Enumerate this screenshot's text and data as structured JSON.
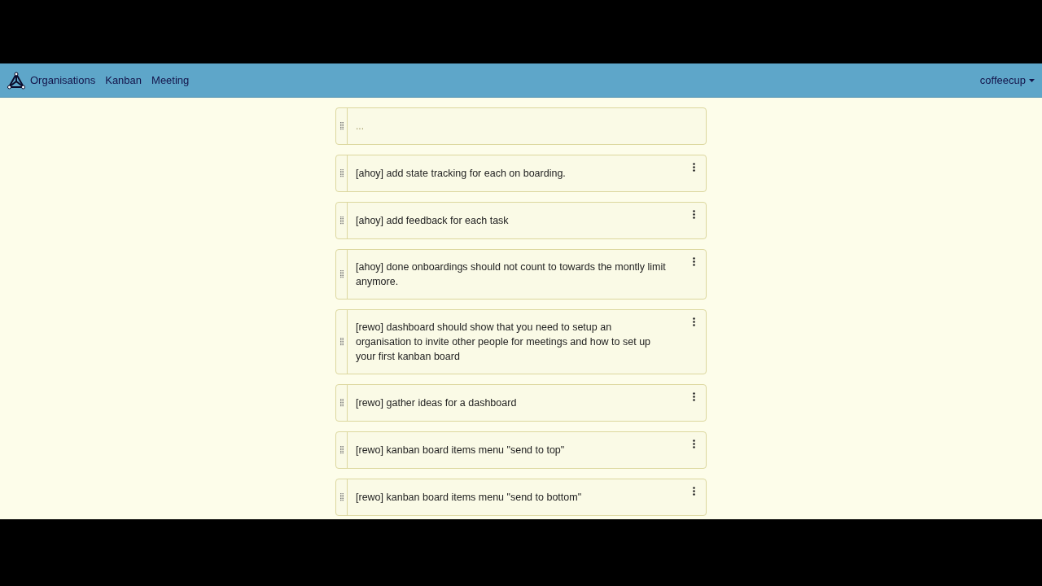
{
  "navbar": {
    "links": [
      "Organisations",
      "Kanban",
      "Meeting"
    ],
    "user_menu": "coffeecup"
  },
  "cards": [
    {
      "kind": "placeholder",
      "text": "..."
    },
    {
      "kind": "task",
      "text": "[ahoy] add state tracking for each on boarding."
    },
    {
      "kind": "task",
      "text": "[ahoy] add feedback for each task"
    },
    {
      "kind": "task",
      "text": "[ahoy] done onboardings should not count to towards the montly limit anymore."
    },
    {
      "kind": "task",
      "text": "[rewo] dashboard should show that you need to setup an organisation to invite other people for meetings and how to set up your first kanban board"
    },
    {
      "kind": "task",
      "text": "[rewo] gather ideas for a dashboard"
    },
    {
      "kind": "task",
      "text": "[rewo] kanban board items menu \"send to top\""
    },
    {
      "kind": "task",
      "text": "[rewo] kanban board items menu \"send to bottom\""
    }
  ]
}
